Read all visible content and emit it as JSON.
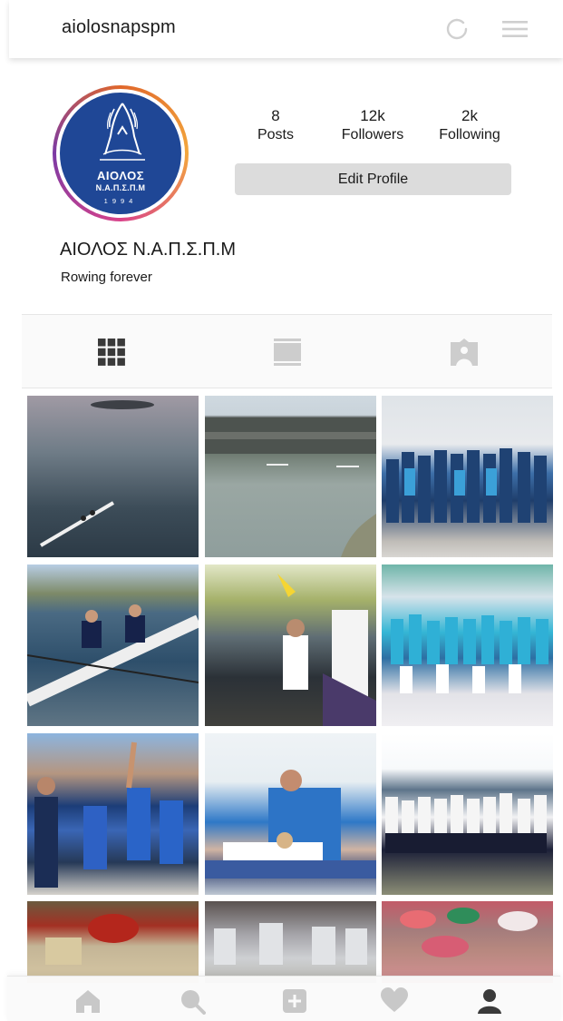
{
  "header": {
    "username": "aiolosnapspm",
    "icons": [
      "refresh-icon",
      "menu-icon"
    ]
  },
  "profile": {
    "avatar_text": {
      "line1": "ΑΙΟΛΟΣ",
      "line2": "Ν.Α.Π.Σ.Π.Μ",
      "line3": "1994"
    },
    "stats": {
      "posts": {
        "value": "8",
        "label": "Posts"
      },
      "followers": {
        "value": "12k",
        "label": "Followers"
      },
      "following": {
        "value": "2k",
        "label": "Following"
      }
    },
    "edit_label": "Edit Profile",
    "display_name": "ΑΙΟΛΟΣ Ν.Α.Π.Σ.Π.Μ",
    "bio": "Rowing forever"
  },
  "tabs": [
    {
      "name": "grid-icon",
      "active": true
    },
    {
      "name": "feed-icon",
      "active": false
    },
    {
      "name": "tagged-icon",
      "active": false
    }
  ],
  "photos": [
    {
      "name": "photo-rowers-lake"
    },
    {
      "name": "photo-regatta-stadium"
    },
    {
      "name": "photo-team-airport"
    },
    {
      "name": "photo-double-scull"
    },
    {
      "name": "photo-girls-boat"
    },
    {
      "name": "photo-team-crowd"
    },
    {
      "name": "photo-medalists"
    },
    {
      "name": "photo-massage"
    },
    {
      "name": "photo-girls-team"
    },
    {
      "name": "photo-christmas-table"
    },
    {
      "name": "photo-jars"
    },
    {
      "name": "photo-crafts"
    }
  ],
  "bottom_nav": [
    "home-icon",
    "search-icon",
    "add-icon",
    "heart-icon",
    "profile-icon"
  ],
  "colors": {
    "logo_blue": "#1f4796",
    "button_gray": "#dcdcdc",
    "icon_gray": "#c8c8c8",
    "icon_active": "#3a3a3a"
  }
}
